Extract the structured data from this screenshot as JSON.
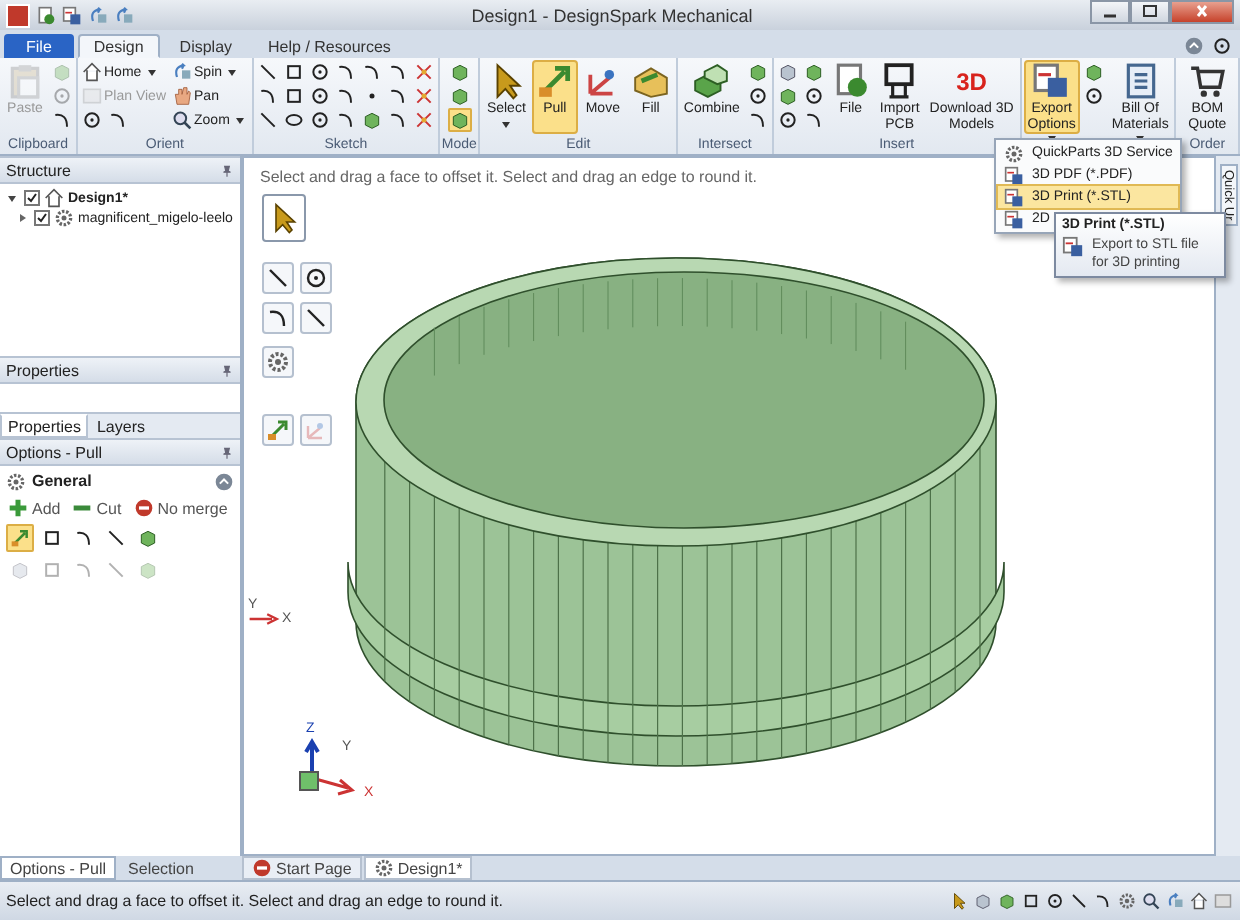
{
  "window": {
    "title": "Design1 - DesignSpark Mechanical"
  },
  "tabs": [
    {
      "label": "File",
      "kind": "file",
      "selected": false
    },
    {
      "label": "Design",
      "kind": "tab",
      "selected": true
    },
    {
      "label": "Display",
      "kind": "tab",
      "selected": false
    },
    {
      "label": "Help / Resources",
      "kind": "tab",
      "selected": false
    }
  ],
  "ribbon": {
    "groups": [
      {
        "label": "Clipboard",
        "columns": [
          [
            {
              "kind": "large",
              "lines": [
                "Paste"
              ],
              "disabled": true,
              "dropdown": false,
              "selected": false
            }
          ],
          [
            {
              "kind": "icons",
              "icons": [
                {
                  "disabled": true,
                  "selected": false
                }
              ]
            },
            {
              "kind": "icons",
              "icons": [
                {
                  "disabled": true,
                  "selected": false
                }
              ]
            },
            {
              "kind": "icons",
              "icons": [
                {
                  "disabled": false,
                  "selected": false
                }
              ]
            }
          ]
        ]
      },
      {
        "label": "Orient",
        "columns": [
          [
            {
              "kind": "small",
              "label": "Home",
              "dropdown": true,
              "disabled": false
            },
            {
              "kind": "small",
              "label": "Plan View",
              "dropdown": false,
              "disabled": true
            },
            {
              "kind": "icons",
              "icons": [
                {
                  "disabled": false,
                  "selected": false
                },
                {
                  "disabled": false,
                  "selected": false
                }
              ]
            }
          ],
          [
            {
              "kind": "small",
              "label": "Spin",
              "dropdown": true,
              "disabled": false
            },
            {
              "kind": "small",
              "label": "Pan",
              "dropdown": false,
              "disabled": false
            },
            {
              "kind": "small",
              "label": "Zoom",
              "dropdown": true,
              "disabled": false
            }
          ]
        ]
      },
      {
        "label": "Sketch",
        "columns": [
          [
            {
              "kind": "icons",
              "icons": [
                {
                  "disabled": false,
                  "selected": false
                },
                {
                  "disabled": false,
                  "selected": false
                },
                {
                  "disabled": false,
                  "selected": false
                },
                {
                  "disabled": false,
                  "selected": false
                },
                {
                  "disabled": false,
                  "selected": false
                },
                {
                  "disabled": false,
                  "selected": false
                },
                {
                  "disabled": false,
                  "selected": false
                }
              ]
            },
            {
              "kind": "icons",
              "icons": [
                {
                  "disabled": false,
                  "selected": false
                },
                {
                  "disabled": false,
                  "selected": false
                },
                {
                  "disabled": false,
                  "selected": false
                },
                {
                  "disabled": false,
                  "selected": false
                },
                {
                  "disabled": false,
                  "selected": false
                },
                {
                  "disabled": false,
                  "selected": false
                },
                {
                  "disabled": false,
                  "selected": false
                }
              ]
            },
            {
              "kind": "icons",
              "icons": [
                {
                  "disabled": false,
                  "selected": false
                },
                {
                  "disabled": false,
                  "selected": false
                },
                {
                  "disabled": false,
                  "selected": false
                },
                {
                  "disabled": false,
                  "selected": false
                },
                {
                  "disabled": false,
                  "selected": false
                },
                {
                  "disabled": false,
                  "selected": false
                },
                {
                  "disabled": false,
                  "selected": false
                }
              ]
            }
          ]
        ]
      },
      {
        "label": "Mode",
        "columns": [
          [
            {
              "kind": "icons",
              "icons": [
                {
                  "disabled": false,
                  "selected": false
                }
              ]
            },
            {
              "kind": "icons",
              "icons": [
                {
                  "disabled": false,
                  "selected": false
                }
              ]
            },
            {
              "kind": "icons",
              "icons": [
                {
                  "disabled": false,
                  "selected": true
                }
              ]
            }
          ]
        ]
      },
      {
        "label": "Edit",
        "columns": [
          [
            {
              "kind": "large",
              "lines": [
                "Select"
              ],
              "dropdown": true,
              "disabled": false,
              "selected": false
            }
          ],
          [
            {
              "kind": "large",
              "lines": [
                "Pull"
              ],
              "dropdown": false,
              "disabled": false,
              "selected": true
            }
          ],
          [
            {
              "kind": "large",
              "lines": [
                "Move"
              ],
              "dropdown": false,
              "disabled": false,
              "selected": false
            }
          ],
          [
            {
              "kind": "large",
              "lines": [
                "Fill"
              ],
              "dropdown": false,
              "disabled": false,
              "selected": false
            }
          ]
        ]
      },
      {
        "label": "Intersect",
        "columns": [
          [
            {
              "kind": "large",
              "lines": [
                "Combine"
              ],
              "dropdown": false,
              "disabled": false,
              "selected": false
            }
          ],
          [
            {
              "kind": "icons",
              "icons": [
                {
                  "disabled": false,
                  "selected": false
                }
              ]
            },
            {
              "kind": "icons",
              "icons": [
                {
                  "disabled": false,
                  "selected": false
                }
              ]
            },
            {
              "kind": "icons",
              "icons": [
                {
                  "disabled": false,
                  "selected": false
                }
              ]
            }
          ]
        ]
      },
      {
        "label": "Insert",
        "columns": [
          [
            {
              "kind": "icons",
              "icons": [
                {
                  "disabled": false,
                  "selected": false
                }
              ]
            },
            {
              "kind": "icons",
              "icons": [
                {
                  "disabled": false,
                  "selected": false
                }
              ]
            },
            {
              "kind": "icons",
              "icons": [
                {
                  "disabled": false,
                  "selected": false
                }
              ]
            }
          ],
          [
            {
              "kind": "icons",
              "icons": [
                {
                  "disabled": false,
                  "selected": false
                }
              ]
            },
            {
              "kind": "icons",
              "icons": [
                {
                  "disabled": false,
                  "selected": false
                }
              ]
            },
            {
              "kind": "icons",
              "icons": [
                {
                  "disabled": false,
                  "selected": false
                }
              ]
            }
          ],
          [
            {
              "kind": "large",
              "lines": [
                "File"
              ],
              "dropdown": false,
              "disabled": false,
              "selected": false
            }
          ],
          [
            {
              "kind": "large",
              "lines": [
                "Import",
                "PCB"
              ],
              "dropdown": false,
              "disabled": false,
              "selected": false
            }
          ],
          [
            {
              "kind": "large",
              "lines": [
                "Download 3D",
                "Models"
              ],
              "logo": "3D",
              "dropdown": false,
              "disabled": false,
              "selected": false
            }
          ]
        ]
      },
      {
        "columns": [
          [
            {
              "kind": "large",
              "lines": [
                "Export",
                "Options"
              ],
              "dropdown": true,
              "disabled": false,
              "selected": true
            }
          ],
          [
            {
              "kind": "icons",
              "icons": [
                {
                  "disabled": false,
                  "selected": false
                }
              ]
            },
            {
              "kind": "icons",
              "icons": [
                {
                  "disabled": false,
                  "selected": false
                }
              ]
            }
          ],
          [
            {
              "kind": "large",
              "lines": [
                "Bill Of",
                "Materials"
              ],
              "dropdown": true,
              "disabled": false,
              "selected": false
            }
          ]
        ]
      },
      {
        "label": "Order",
        "columns": [
          [
            {
              "kind": "large",
              "lines": [
                "BOM",
                "Quote"
              ],
              "dropdown": false,
              "disabled": false,
              "selected": false
            }
          ]
        ]
      }
    ]
  },
  "structure": {
    "title": "Structure",
    "tree": [
      {
        "label": "Design1*",
        "checked": true,
        "expanded": true,
        "children": [
          {
            "label": "magnificent_migelo-leelo",
            "checked": true,
            "expanded": false
          }
        ]
      }
    ]
  },
  "properties": {
    "title": "Properties",
    "tabs": [
      {
        "label": "Properties",
        "selected": true
      },
      {
        "label": "Layers",
        "selected": false
      }
    ]
  },
  "options": {
    "title": "Options - Pull",
    "section": "General",
    "actions": [
      {
        "label": "Add",
        "kind": "add"
      },
      {
        "label": "Cut",
        "kind": "cut"
      },
      {
        "label": "No merge",
        "kind": "nomerge"
      }
    ],
    "tool_rows": [
      [
        {
          "selected": true,
          "disabled": false
        },
        {
          "selected": false,
          "disabled": false
        },
        {
          "selected": false,
          "disabled": false
        },
        {
          "selected": false,
          "disabled": false
        },
        {
          "selected": false,
          "disabled": false
        }
      ],
      [
        {
          "selected": false,
          "disabled": true
        },
        {
          "selected": false,
          "disabled": true
        },
        {
          "selected": false,
          "disabled": true
        },
        {
          "selected": false,
          "disabled": true
        },
        {
          "selected": false,
          "disabled": true
        }
      ]
    ]
  },
  "left_tabs": [
    {
      "label": "Options - Pull",
      "selected": true
    },
    {
      "label": "Selection",
      "selected": false
    }
  ],
  "viewport": {
    "hint": "Select and drag a face to offset it. Select and drag an edge to round it.",
    "palette": [
      {
        "selected": true,
        "disabled": false
      },
      {
        "selected": false,
        "disabled": false
      },
      {
        "selected": false,
        "disabled": false
      },
      {
        "selected": false,
        "disabled": false
      },
      {
        "selected": false,
        "disabled": false
      },
      {
        "selected": false,
        "disabled": false
      },
      {
        "selected": false,
        "disabled": false
      },
      {
        "selected": false,
        "disabled": true
      }
    ],
    "edge_axes": {
      "y": "Y",
      "x": "X"
    },
    "triad": {
      "z": "Z",
      "y": "Y",
      "x": "X"
    },
    "side_tab": "Quick Ur"
  },
  "doc_tabs": [
    {
      "label": "Start Page",
      "selected": false
    },
    {
      "label": "Design1*",
      "selected": true
    }
  ],
  "export_menu": [
    {
      "label": "QuickParts 3D Service",
      "selected": false
    },
    {
      "label": "3D PDF (*.PDF)",
      "selected": false
    },
    {
      "label": "3D Print (*.STL)",
      "selected": true
    },
    {
      "label": "2D",
      "selected": false
    }
  ],
  "tooltip": {
    "title": "3D Print (*.STL)",
    "text": "Export to STL file for 3D printing"
  },
  "status_bar": {
    "text": "Select and drag a face to offset it. Select and drag an edge to round it."
  }
}
